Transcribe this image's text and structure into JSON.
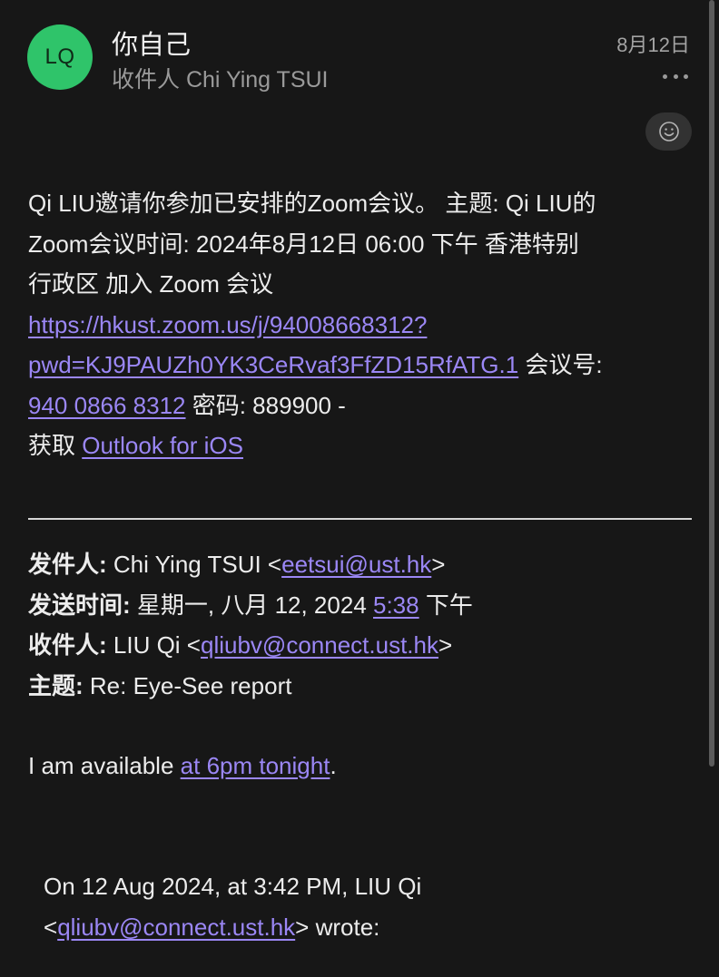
{
  "header": {
    "avatar_initials": "LQ",
    "sender_name": "你自己",
    "recipient_line": "收件人 Chi Ying TSUI",
    "date": "8月12日"
  },
  "body": {
    "line1": "Qi LIU邀请你参加已安排的Zoom会议。 主题: Qi LIU的",
    "line2": "Zoom会议时间: 2024年8月12日 06:00 下午 香港特别",
    "line3": "行政区 加入 Zoom 会议",
    "zoom_link_part1": "https://hkust.zoom.us/j/94008668312?",
    "zoom_link_part2": "pwd=KJ9PAUZh0YK3CeRvaf3FfZD15RfATG.1",
    "meeting_id_label": " 会议号:",
    "meeting_id": "940 0866 8312",
    "password_text": " 密码: 889900 -",
    "get_label": "获取 ",
    "outlook_link": "Outlook for iOS"
  },
  "quoted_header": {
    "from_label": "发件人:",
    "from_name": " Chi Ying TSUI <",
    "from_email": "eetsui@ust.hk",
    "from_close": ">",
    "sent_label": "发送时间:",
    "sent_date": " 星期一, 八月 12, 2024 ",
    "sent_time": "5:38",
    "sent_suffix": " 下午",
    "to_label": "收件人:",
    "to_name": " LIU Qi <",
    "to_email": "qliubv@connect.ust.hk",
    "to_close": ">",
    "subject_label": "主题:",
    "subject_value": " Re: Eye-See report"
  },
  "reply": {
    "prefix": "I am available ",
    "time_link": "at 6pm tonight",
    "suffix": "."
  },
  "quote": {
    "line1": "On 12 Aug 2024, at 3:42 PM, LIU Qi",
    "open": "<",
    "email": "qliubv@connect.ust.hk",
    "close": "> wrote:"
  },
  "icons": {
    "more": "more-horizontal-icon",
    "react": "smiley-face-icon"
  },
  "colors": {
    "background": "#171717",
    "avatar": "#2fc46a",
    "link": "#9b87f5",
    "secondary_text": "#9a9a9a"
  }
}
